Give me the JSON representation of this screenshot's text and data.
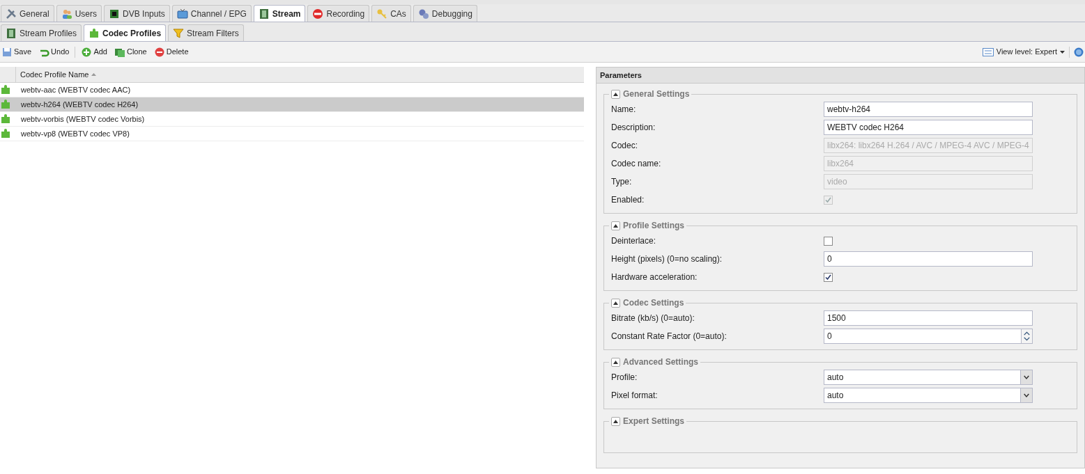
{
  "main_tabs": [
    {
      "label": "General",
      "selected": false
    },
    {
      "label": "Users",
      "selected": false
    },
    {
      "label": "DVB Inputs",
      "selected": false
    },
    {
      "label": "Channel / EPG",
      "selected": false
    },
    {
      "label": "Stream",
      "selected": true
    },
    {
      "label": "Recording",
      "selected": false
    },
    {
      "label": "CAs",
      "selected": false
    },
    {
      "label": "Debugging",
      "selected": false
    }
  ],
  "sub_tabs": [
    {
      "label": "Stream Profiles",
      "selected": false
    },
    {
      "label": "Codec Profiles",
      "selected": true
    },
    {
      "label": "Stream Filters",
      "selected": false
    }
  ],
  "toolbar": {
    "buttons": [
      {
        "label": "Save"
      },
      {
        "label": "Undo"
      },
      {
        "label": "Add"
      },
      {
        "label": "Clone"
      },
      {
        "label": "Delete"
      }
    ],
    "view_level": "View level: Expert"
  },
  "grid": {
    "column": "Codec Profile Name",
    "rows": [
      {
        "name": "webtv-aac (WEBTV codec AAC)",
        "selected": false
      },
      {
        "name": "webtv-h264 (WEBTV codec H264)",
        "selected": true
      },
      {
        "name": "webtv-vorbis (WEBTV codec Vorbis)",
        "selected": false
      },
      {
        "name": "webtv-vp8 (WEBTV codec VP8)",
        "selected": false
      }
    ]
  },
  "parameters": {
    "title": "Parameters",
    "sections": [
      {
        "title": "General Settings",
        "expanded": true,
        "fields": [
          {
            "label": "Name:",
            "kind": "text",
            "value": "webtv-h264",
            "disabled": false
          },
          {
            "label": "Description:",
            "kind": "text",
            "value": "WEBTV codec H264",
            "disabled": false
          },
          {
            "label": "Codec:",
            "kind": "text",
            "value": "libx264: libx264 H.264 / AVC / MPEG-4 AVC / MPEG-4",
            "disabled": true
          },
          {
            "label": "Codec name:",
            "kind": "text",
            "value": "libx264",
            "disabled": true
          },
          {
            "label": "Type:",
            "kind": "text",
            "value": "video",
            "disabled": true
          },
          {
            "label": "Enabled:",
            "kind": "checkbox",
            "checked": true,
            "disabled": true
          }
        ]
      },
      {
        "title": "Profile Settings",
        "expanded": true,
        "fields": [
          {
            "label": "Deinterlace:",
            "kind": "checkbox",
            "checked": false,
            "disabled": false
          },
          {
            "label": "Height (pixels) (0=no scaling):",
            "kind": "text",
            "value": "0",
            "disabled": false
          },
          {
            "label": "Hardware acceleration:",
            "kind": "checkbox",
            "checked": true,
            "disabled": false
          }
        ]
      },
      {
        "title": "Codec Settings",
        "expanded": true,
        "fields": [
          {
            "label": "Bitrate (kb/s) (0=auto):",
            "kind": "text",
            "value": "1500",
            "disabled": false
          },
          {
            "label": "Constant Rate Factor (0=auto):",
            "kind": "spinner",
            "value": "0",
            "disabled": false
          }
        ]
      },
      {
        "title": "Advanced Settings",
        "expanded": true,
        "fields": [
          {
            "label": "Profile:",
            "kind": "select",
            "value": "auto",
            "disabled": false
          },
          {
            "label": "Pixel format:",
            "kind": "select",
            "value": "auto",
            "disabled": false
          }
        ]
      },
      {
        "title": "Expert Settings",
        "expanded": true
      }
    ]
  }
}
